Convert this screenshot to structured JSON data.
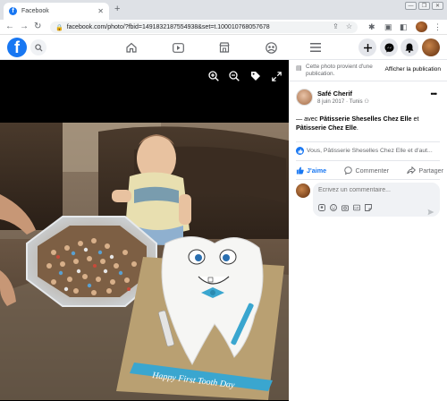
{
  "browser": {
    "tab_title": "Facebook",
    "tab_close": "✕",
    "new_tab": "+",
    "url": "facebook.com/photo/?fbid=1491832187554938&set=t.100010768057678",
    "window_controls": [
      "—",
      "❐",
      "✕"
    ]
  },
  "fb_header": {
    "logo": "f",
    "icons": [
      "home-icon",
      "video-icon",
      "marketplace-icon",
      "groups-icon",
      "menu-icon"
    ],
    "right_buttons": [
      "plus-icon",
      "messenger-icon",
      "bell-icon"
    ]
  },
  "viewer": {
    "tools": [
      "zoom-in-icon",
      "zoom-out-icon",
      "tag-icon",
      "fullscreen-icon"
    ]
  },
  "panel": {
    "notice_text": "Cette photo provient d'une publication.",
    "notice_link": "Afficher la publication",
    "author": "Safé Cherif",
    "date": "8 juin 2017",
    "location": "Tunis",
    "caption_prefix": "— avec ",
    "caption_tag1": "Pâtisserie Sheselles Chez Elle",
    "caption_and": " et ",
    "caption_tag2": "Pâtisserie Chez Elle",
    "caption_suffix": ".",
    "reactions_text": "Vous, Pâtisserie Sheselles Chez Elle et d'aut...",
    "action_like": "J'aime",
    "action_comment": "Commenter",
    "action_share": "Partager",
    "comment_placeholder": "Écrivez un commentaire..."
  },
  "colors": {
    "fb_blue": "#1877f2",
    "secondary_text": "#65676b",
    "viewer_bg": "#000000"
  }
}
